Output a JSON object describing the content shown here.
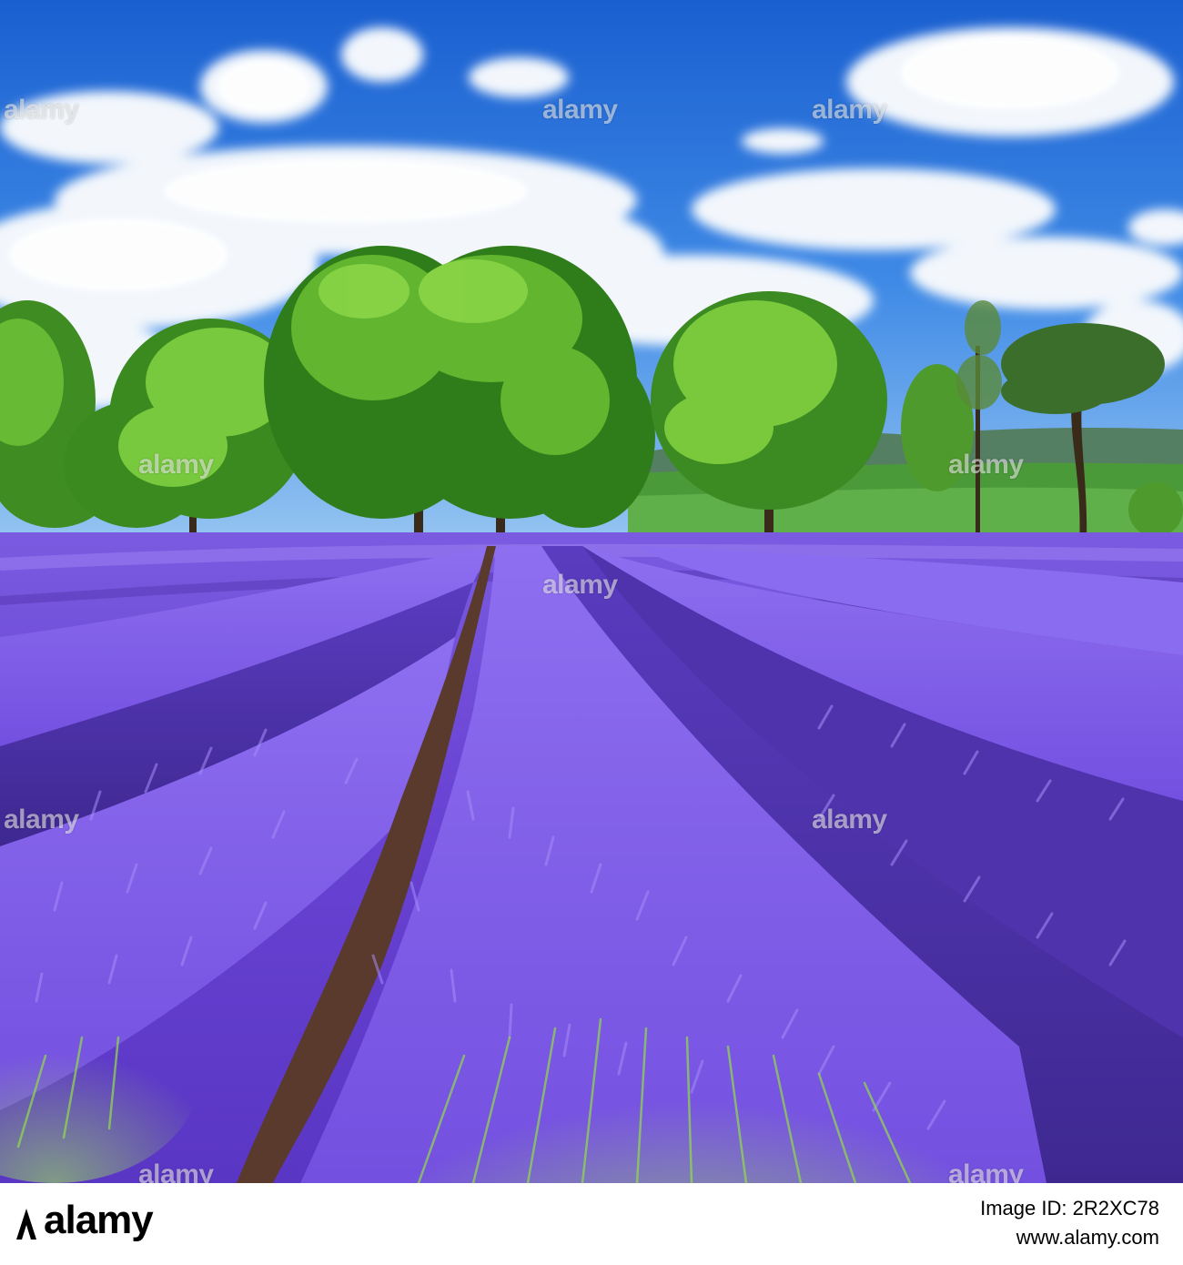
{
  "photo": {
    "description_icon": "landscape-photo",
    "watermark_text": "alamy",
    "colors": {
      "sky_top": "#1e66d6",
      "sky_bottom": "#62a9ee",
      "cloud": "#f4f8fc",
      "tree_dark": "#2f7f1a",
      "tree_light": "#7cc63a",
      "hills": "#4f8f4a",
      "lavender_dark": "#4a2d9c",
      "lavender_mid": "#6a45d6",
      "lavender_light": "#8f6bf0",
      "soil": "#5a3a2a",
      "stem_green": "#8fd14f"
    }
  },
  "footer": {
    "brand": "alamy",
    "image_id_label": "Image ID:",
    "image_id": "2R2XC78",
    "url": "www.alamy.com"
  }
}
